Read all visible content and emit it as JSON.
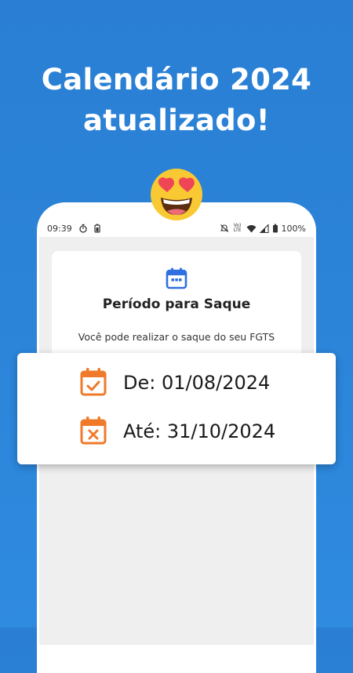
{
  "headline": {
    "line1": "Calendário 2024",
    "line2": "atualizado!"
  },
  "status_bar": {
    "time": "09:39",
    "battery": "100%",
    "network_label": "Vo) LTE",
    "icons": [
      "timer-icon",
      "battery-saver-icon",
      "mute-icon",
      "wifi-icon",
      "signal-icon",
      "battery-icon"
    ]
  },
  "card": {
    "icon": "calendar-icon",
    "title": "Período para Saque",
    "subtitle": "Você pode realizar o saque do seu FGTS"
  },
  "dates": {
    "from_label": "De: 01/08/2024",
    "to_label": "Até: 31/10/2024",
    "from_icon": "calendar-check-icon",
    "to_icon": "calendar-x-icon"
  },
  "colors": {
    "background": "#2b84d8",
    "accent_orange": "#f07a2a",
    "card_icon_blue": "#2f6fe0",
    "emoji_yellow": "#f9c933",
    "emoji_heart": "#ef4657"
  },
  "emoji": "heart-eyes-emoji"
}
